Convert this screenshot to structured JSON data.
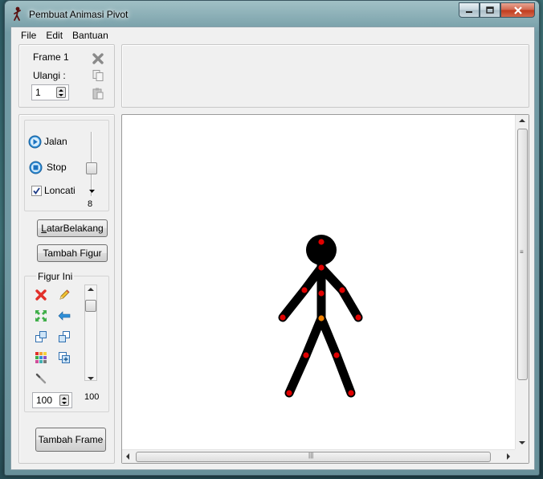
{
  "window": {
    "title": "Pembuat Animasi Pivot"
  },
  "menu": [
    "File",
    "Edit",
    "Bantuan"
  ],
  "frame_panel": {
    "frame_label": "Frame 1",
    "repeat_label": "Ulangi :",
    "repeat_value": "1"
  },
  "playback": {
    "play_label": "Jalan",
    "stop_label": "Stop",
    "loop_label": "Loncati",
    "loop_checked": true,
    "speed_value": "8"
  },
  "buttons": {
    "background": "LatarBelakang",
    "add_figure": "Tambah Figur",
    "add_frame": "Tambah Frame"
  },
  "figure_panel": {
    "title": "Figur Ini",
    "scale_value": "100",
    "opacity_value": "100"
  },
  "colors": {
    "stick": "#000000",
    "handle": "#e00000",
    "origin_handle": "#f08000",
    "canvas": "#ffffff"
  }
}
